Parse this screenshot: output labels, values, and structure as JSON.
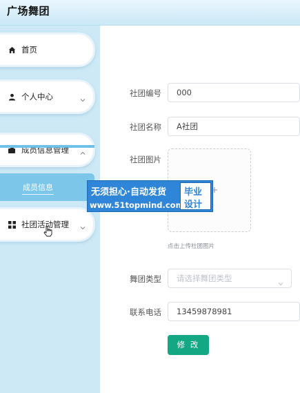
{
  "header": {
    "title": "广场舞团"
  },
  "sidebar": {
    "items": [
      {
        "label": "首页",
        "icon": "home-icon"
      },
      {
        "label": "个人中心",
        "icon": "user-icon"
      },
      {
        "label": "成员信息管理",
        "icon": "wallet-icon"
      },
      {
        "label": "社团活动管理",
        "icon": "grid-icon"
      }
    ],
    "active_sub_item": "成员信息"
  },
  "form": {
    "club_id": {
      "label": "社团编号",
      "value": "000"
    },
    "club_name": {
      "label": "社团名称",
      "value": "A社团"
    },
    "club_image": {
      "label": "社团图片",
      "tip": "点击上传社团图片"
    },
    "dance_type": {
      "label": "舞团类型",
      "placeholder": "请选择舞团类型"
    },
    "phone": {
      "label": "联系电话",
      "value": "13459878981"
    },
    "submit_label": "修 改"
  },
  "watermark": {
    "line1": "无须担心·自动发货",
    "line2": "www.51topmind.com",
    "badge_line1": "毕业",
    "badge_line2": "设计"
  },
  "colors": {
    "sidebar_bg": "#cde9f6",
    "active_item_bg": "#7cc6ea",
    "primary_button": "#14a783",
    "watermark_bg": "#2f86d8"
  }
}
